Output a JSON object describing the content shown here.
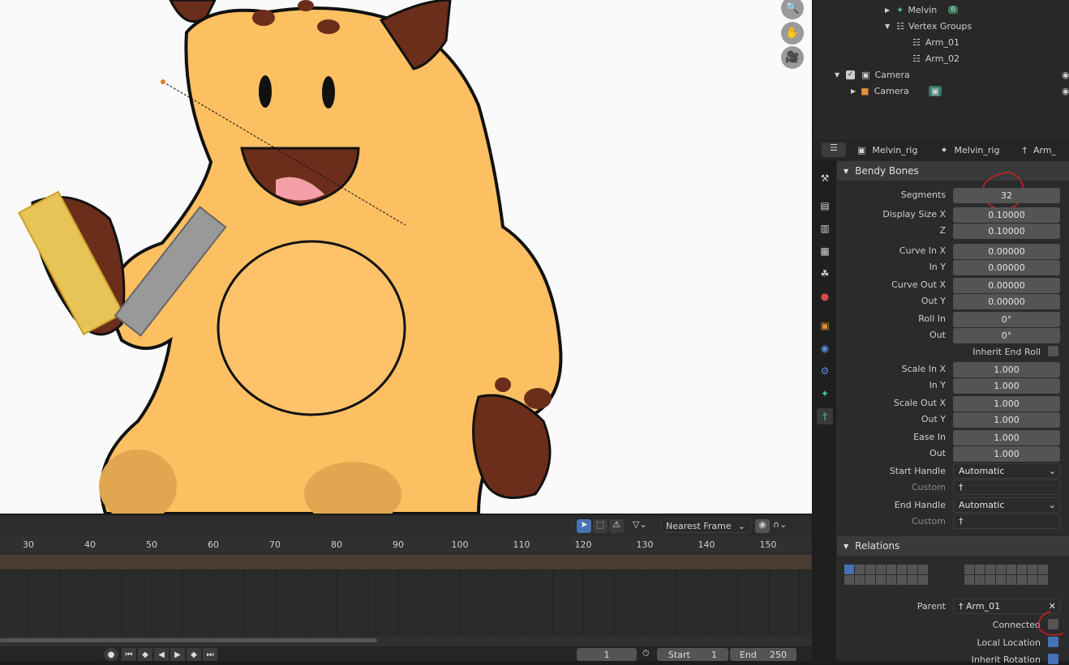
{
  "outliner": {
    "rows": [
      {
        "label": "Melvin",
        "badge": "6"
      },
      {
        "label": "Vertex Groups"
      },
      {
        "label": "Arm_01"
      },
      {
        "label": "Arm_02"
      },
      {
        "label": "Camera"
      },
      {
        "label": "Camera"
      }
    ]
  },
  "props_header": {
    "item1": "Melvin_rig",
    "item2": "Melvin_rig",
    "item3": "Arm_"
  },
  "bendy": {
    "title": "Bendy Bones",
    "rows": [
      {
        "label": "Segments",
        "value": "32"
      },
      {
        "label": "Display Size X",
        "value": "0.10000"
      },
      {
        "label": "Z",
        "value": "0.10000"
      },
      {
        "label": "Curve In X",
        "value": "0.00000"
      },
      {
        "label": "In Y",
        "value": "0.00000"
      },
      {
        "label": "Curve Out X",
        "value": "0.00000"
      },
      {
        "label": "Out Y",
        "value": "0.00000"
      },
      {
        "label": "Roll In",
        "value": "0°"
      },
      {
        "label": "Out",
        "value": "0°"
      },
      {
        "label": "Scale In X",
        "value": "1.000"
      },
      {
        "label": "In Y",
        "value": "1.000"
      },
      {
        "label": "Scale Out X",
        "value": "1.000"
      },
      {
        "label": "Out Y",
        "value": "1.000"
      },
      {
        "label": "Ease In",
        "value": "1.000"
      },
      {
        "label": "Out",
        "value": "1.000"
      }
    ],
    "inherit_end_roll": "Inherit End Roll",
    "start_handle_label": "Start Handle",
    "start_handle_value": "Automatic",
    "custom_label": "Custom",
    "end_handle_label": "End Handle",
    "end_handle_value": "Automatic",
    "custom_label2": "Custom"
  },
  "relations": {
    "title": "Relations",
    "parent_label": "Parent",
    "parent_value": "Arm_01",
    "connected_label": "Connected",
    "local_location_label": "Local Location",
    "inherit_rotation_label": "Inherit Rotation"
  },
  "timeline": {
    "snap_mode": "Nearest Frame",
    "ticks": [
      "30",
      "40",
      "50",
      "60",
      "70",
      "80",
      "90",
      "100",
      "110",
      "120",
      "130",
      "140",
      "150"
    ],
    "current_frame": "1",
    "start_label": "Start",
    "start_value": "1",
    "end_label": "End",
    "end_value": "250"
  }
}
